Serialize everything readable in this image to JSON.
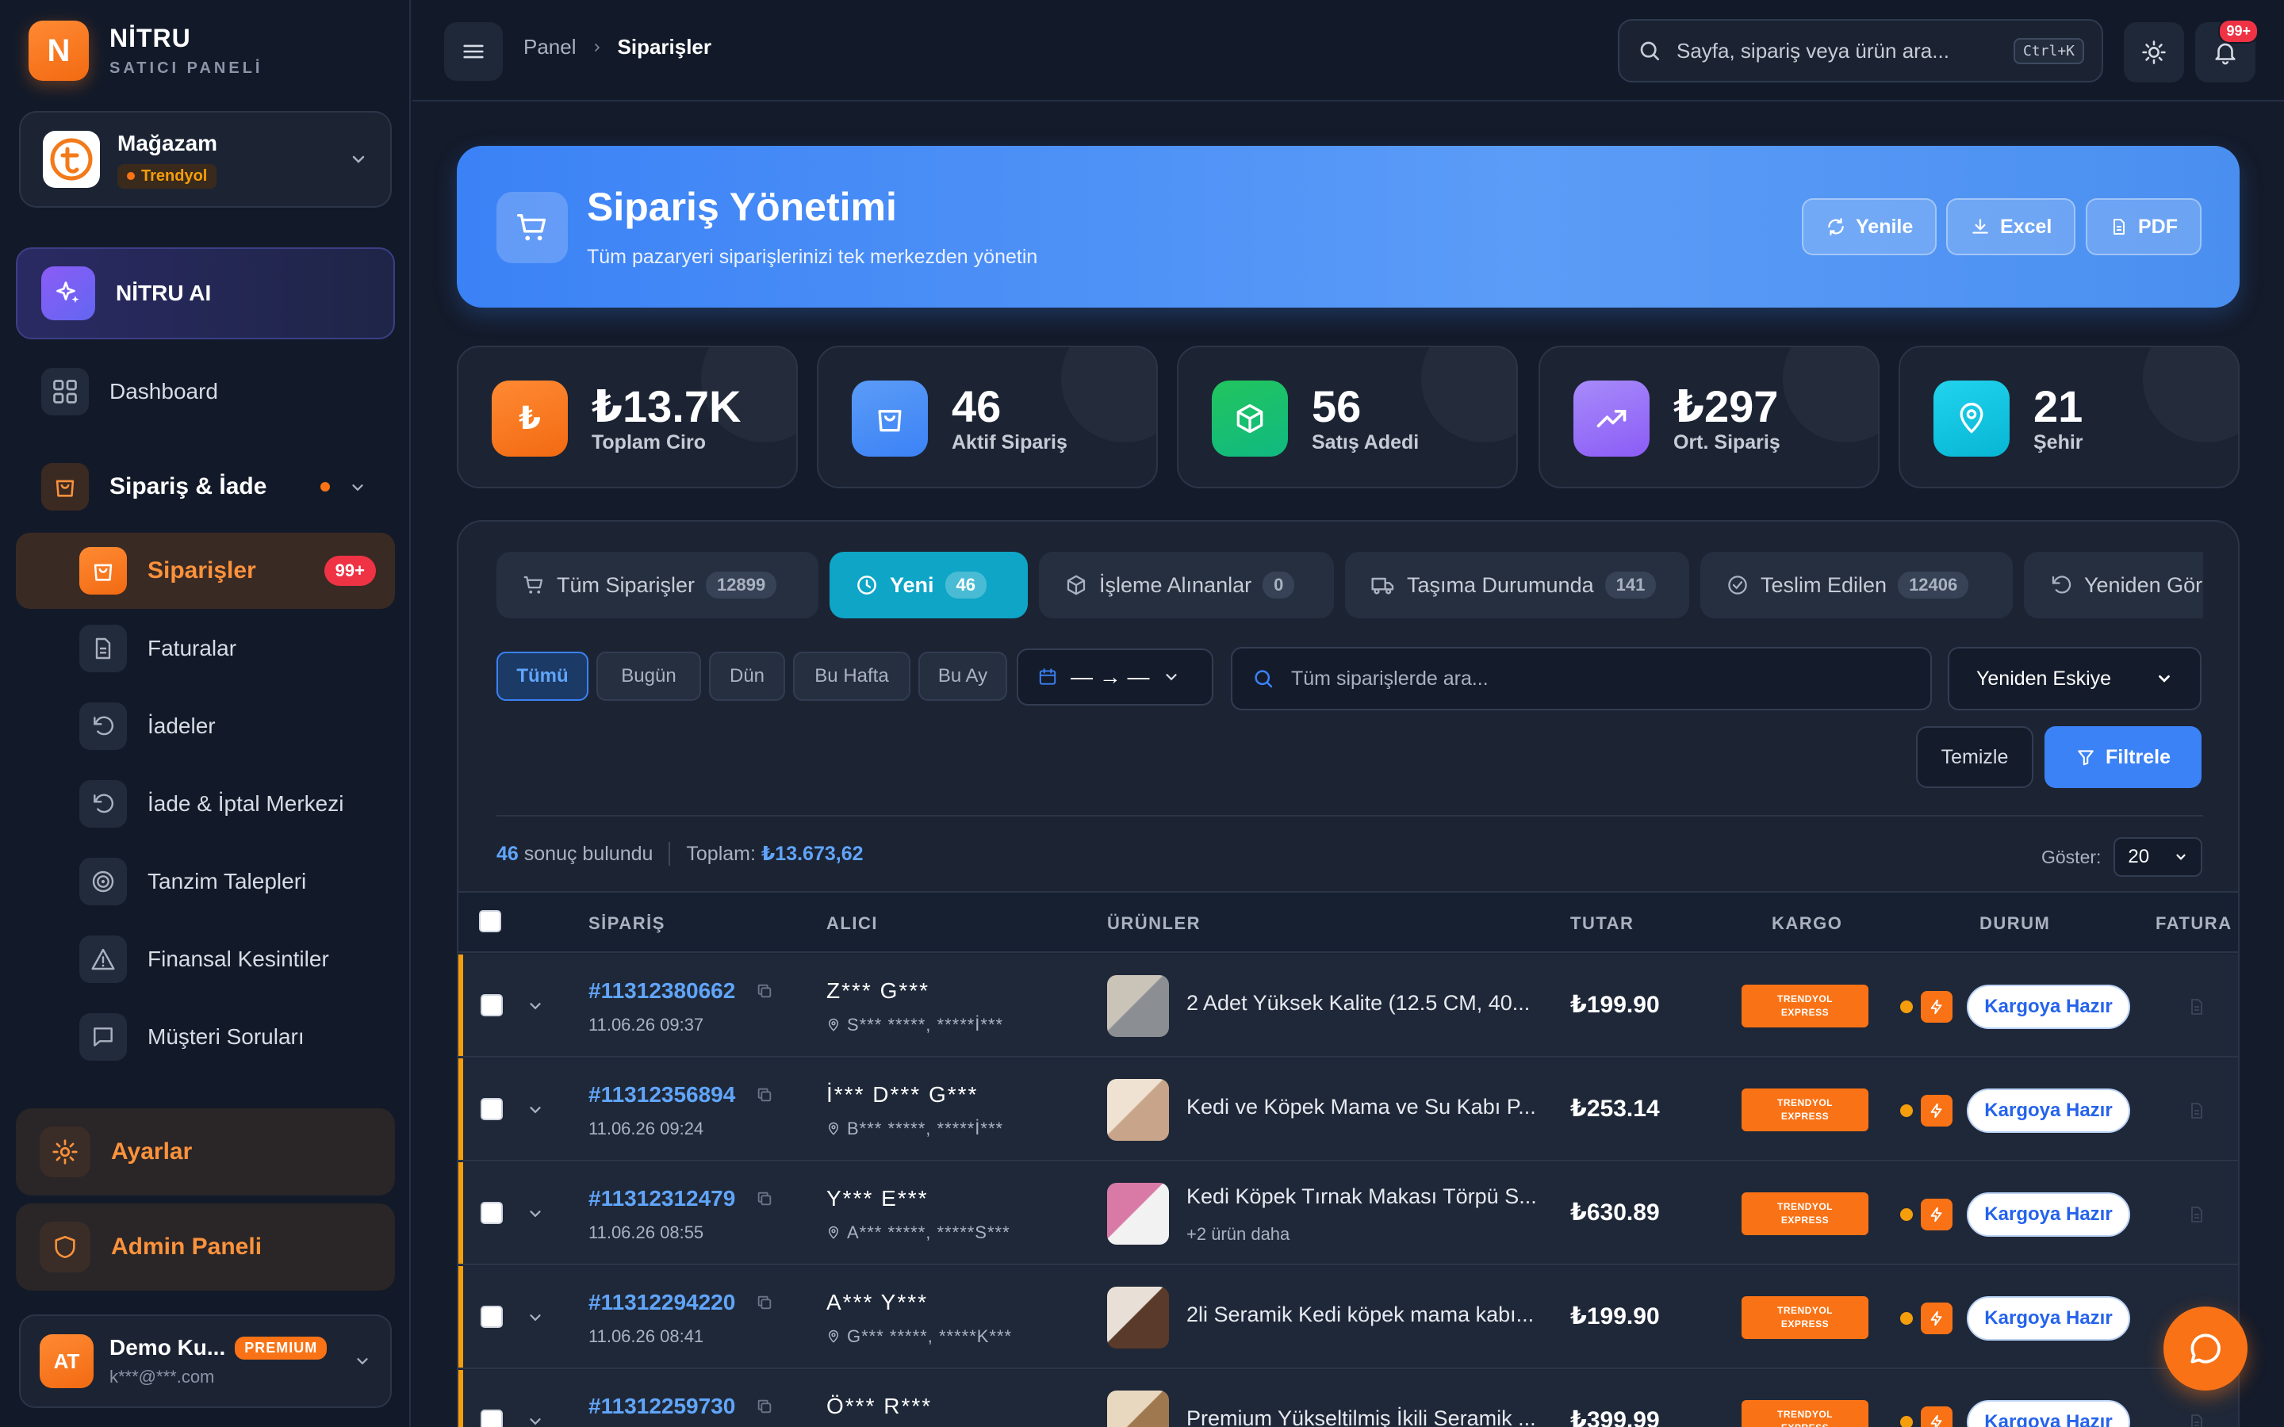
{
  "brand": {
    "initial": "N",
    "name": "NİTRU",
    "subtitle": "SATICI PANELİ"
  },
  "store": {
    "name": "Mağazam",
    "marketplace": "Trendyol"
  },
  "sidebar": {
    "ai_label": "NİTRU AI",
    "dashboard": "Dashboard",
    "section_label": "Sipariş & İade",
    "items": [
      {
        "label": "Siparişler",
        "badge": "99+",
        "icon": "shopping-bag-icon",
        "active": true
      },
      {
        "label": "Faturalar",
        "icon": "invoice-icon"
      },
      {
        "label": "İadeler",
        "icon": "undo-icon"
      },
      {
        "label": "İade & İptal Merkezi",
        "icon": "undo-icon"
      },
      {
        "label": "Tanzim Talepleri",
        "icon": "target-icon"
      },
      {
        "label": "Finansal Kesintiler",
        "icon": "warning-icon"
      },
      {
        "label": "Müşteri Soruları",
        "icon": "chat-icon"
      }
    ],
    "settings": "Ayarlar",
    "admin": "Admin Paneli"
  },
  "user": {
    "initials": "AT",
    "name": "Demo Ku...",
    "plan": "PREMIUM",
    "email": "k***@***.com"
  },
  "topbar": {
    "breadcrumb": [
      "Panel",
      "Siparişler"
    ],
    "search_placeholder": "Sayfa, sipariş veya ürün ara...",
    "shortcut": "Ctrl+K",
    "notification_count": "99+"
  },
  "hero": {
    "title": "Sipariş Yönetimi",
    "subtitle": "Tüm pazaryeri siparişlerinizi tek merkezden yönetin",
    "buttons": [
      "Yenile",
      "Excel",
      "PDF"
    ]
  },
  "stats": [
    {
      "value": "₺13.7K",
      "label": "Toplam Ciro",
      "color": "#f97316"
    },
    {
      "value": "46",
      "label": "Aktif Sipariş",
      "color": "#3b82f6"
    },
    {
      "value": "56",
      "label": "Satış Adedi",
      "color": "#10b981"
    },
    {
      "value": "₺297",
      "label": "Ort. Sipariş",
      "color": "#8b5cf6"
    },
    {
      "value": "21",
      "label": "Şehir",
      "color": "#06b6d4"
    }
  ],
  "tabs": [
    {
      "label": "Tüm Siparişler",
      "count": "12899"
    },
    {
      "label": "Yeni",
      "count": "46",
      "active": true
    },
    {
      "label": "İşleme Alınanlar",
      "count": "0"
    },
    {
      "label": "Taşıma Durumunda",
      "count": "141"
    },
    {
      "label": "Teslim Edilen",
      "count": "12406"
    },
    {
      "label": "Yeniden Gör"
    }
  ],
  "filters": {
    "periods": [
      "Tümü",
      "Bugün",
      "Dün",
      "Bu Hafta",
      "Bu Ay"
    ],
    "active_period": "Tümü",
    "date_range": "— → —",
    "search_placeholder": "Tüm siparişlerde ara...",
    "sort": "Yeniden Eskiye",
    "clear": "Temizle",
    "filter": "Filtrele"
  },
  "summary": {
    "count": "46",
    "count_suffix": "sonuç bulundu",
    "total_label": "Toplam:",
    "total": "₺13.673,62",
    "show_label": "Göster:",
    "page_size": "20"
  },
  "table": {
    "headers": [
      "SİPARİŞ",
      "ALICI",
      "ÜRÜNLER",
      "TUTAR",
      "KARGO",
      "DURUM",
      "FATURA"
    ],
    "rows": [
      {
        "order": "#11312380662",
        "date": "11.06.26 09:37",
        "customer": "Z*** G***",
        "address": "S*** *****, *****İ***",
        "product": "2 Adet Yüksek Kalite (12.5 CM, 40...",
        "more": "",
        "amount": "₺199.90",
        "cargo": "TRENDYOL EXPRESS",
        "status": "Kargoya Hazır"
      },
      {
        "order": "#11312356894",
        "date": "11.06.26 09:24",
        "customer": "İ*** D*** G***",
        "address": "B*** *****, *****İ***",
        "product": "Kedi ve Köpek Mama ve Su Kabı P...",
        "more": "",
        "amount": "₺253.14",
        "cargo": "TRENDYOL EXPRESS",
        "status": "Kargoya Hazır"
      },
      {
        "order": "#11312312479",
        "date": "11.06.26 08:55",
        "customer": "Y*** E***",
        "address": "A*** *****, *****S***",
        "product": "Kedi Köpek Tırnak Makası Törpü S...",
        "more": "+2 ürün daha",
        "amount": "₺630.89",
        "cargo": "TRENDYOL EXPRESS",
        "status": "Kargoya Hazır"
      },
      {
        "order": "#11312294220",
        "date": "11.06.26 08:41",
        "customer": "A*** Y***",
        "address": "G*** *****, *****K***",
        "product": "2li Seramik Kedi köpek mama kabı...",
        "more": "",
        "amount": "₺199.90",
        "cargo": "TRENDYOL EXPRESS",
        "status": "Kargoya Hazır"
      },
      {
        "order": "#11312259730",
        "date": "",
        "customer": "Ö*** R***",
        "address": "",
        "product": "Premium Yükseltilmiş İkili Seramik ...",
        "more": "",
        "amount": "₺399.99",
        "cargo": "TRENDYOL EXPRESS",
        "status": "Kargoya Hazır"
      }
    ]
  }
}
